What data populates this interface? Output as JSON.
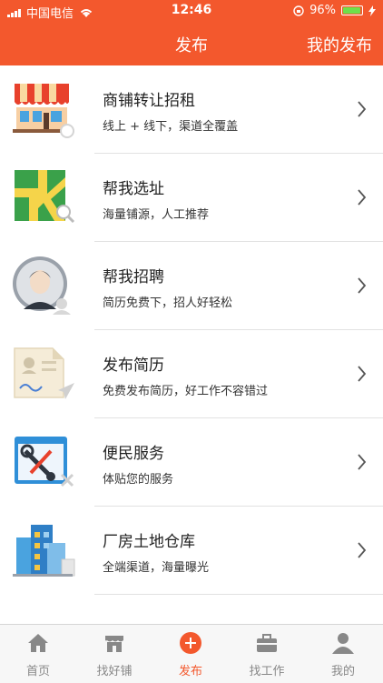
{
  "status_bar": {
    "carrier": "中国电信",
    "time": "12:46",
    "battery": "96%",
    "battery_level": 0.96
  },
  "header": {
    "title": "发布",
    "action": "我的发布"
  },
  "colors": {
    "brand": "#f3582d",
    "text": "#222222",
    "divider": "#e2e2e2",
    "tab_inactive": "#888888"
  },
  "items": [
    {
      "title": "商铺转让招租",
      "subtitle": "线上 + 线下，渠道全覆盖",
      "icon": "storefront-icon"
    },
    {
      "title": "帮我选址",
      "subtitle": "海量铺源，人工推荐",
      "icon": "map-search-icon"
    },
    {
      "title": "帮我招聘",
      "subtitle": "简历免费下，招人好轻松",
      "icon": "recruit-person-icon"
    },
    {
      "title": "发布简历",
      "subtitle": "免费发布简历，好工作不容错过",
      "icon": "resume-icon"
    },
    {
      "title": "便民服务",
      "subtitle": "体贴您的服务",
      "icon": "tools-icon"
    },
    {
      "title": "厂房土地仓库",
      "subtitle": "全端渠道，海量曝光",
      "icon": "building-icon"
    }
  ],
  "tabs": [
    {
      "label": "首页",
      "icon": "home-icon",
      "active": false
    },
    {
      "label": "找好铺",
      "icon": "shop-icon",
      "active": false
    },
    {
      "label": "发布",
      "icon": "add-circle-icon",
      "active": true
    },
    {
      "label": "找工作",
      "icon": "briefcase-icon",
      "active": false
    },
    {
      "label": "我的",
      "icon": "user-icon",
      "active": false
    }
  ]
}
